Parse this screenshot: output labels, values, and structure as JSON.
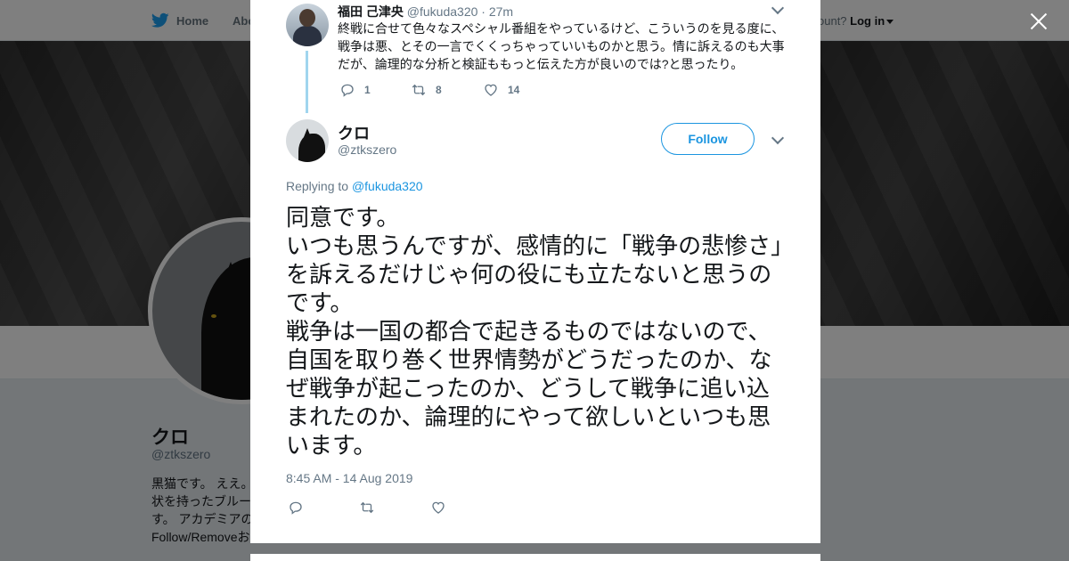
{
  "background": {
    "nav": {
      "home": "Home",
      "about": "Abo",
      "account_prompt": "ccount?",
      "login": "Log in"
    },
    "profile": {
      "name": "クロ",
      "handle": "@ztkszero",
      "bio_lines": [
        "黒猫です。 ええ。",
        "状を持ったブルー",
        "す。 アカデミアの",
        "Follow/Removeお"
      ]
    }
  },
  "modal": {
    "parent_tweet": {
      "name": "福田 己津央",
      "handle": "@fukuda320",
      "time": "· 27m",
      "text": "終戦に合せて色々なスペシャル番組をやっているけど、こういうのを見る度に、戦争は悪、とその一言でくくっちゃっていいものかと思う。情に訴えるのも大事だが、論理的な分析と検証ももっと伝えた方が良いのでは?と思ったり。",
      "replies": "1",
      "retweets": "8",
      "likes": "14"
    },
    "main_tweet": {
      "name": "クロ",
      "handle": "@ztkszero",
      "follow_label": "Follow",
      "replying_prefix": "Replying to",
      "replying_to": "@fukuda320",
      "text": "同意です。\nいつも思うんですが、感情的に「戦争の悲惨さ」を訴えるだけじゃ何の役にも立たないと思うのです。\n戦争は一国の都合で起きるものではないので、自国を取り巻く世界情勢がどうだったのか、なぜ戦争が起こったのか、どうして戦争に追い込まれたのか、論理的にやって欲しいといつも思います。",
      "timestamp": "8:45 AM - 14 Aug 2019"
    },
    "colors": {
      "accent": "#1b95e0",
      "thread_line": "#a0d5ee",
      "muted": "#657786"
    }
  }
}
